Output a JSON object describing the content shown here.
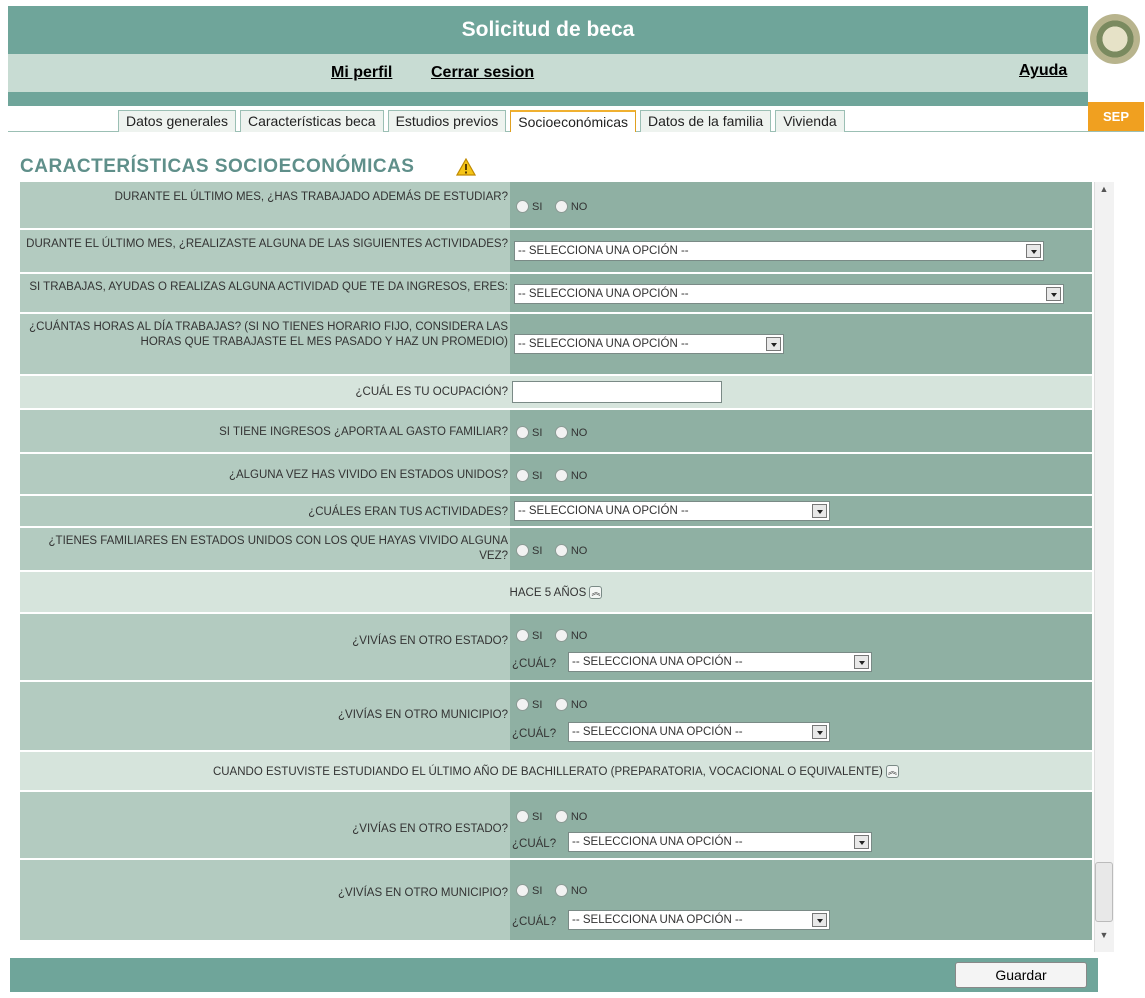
{
  "header": {
    "title": "Solicitud de beca",
    "nav": [
      "Mi perfil",
      "Cerrar sesion"
    ],
    "help": "Ayuda",
    "logo_text": "SEP"
  },
  "tabs": [
    {
      "label": "Datos generales",
      "active": false
    },
    {
      "label": "Características beca",
      "active": false
    },
    {
      "label": "Estudios previos",
      "active": false
    },
    {
      "label": "Socioeconómicas",
      "active": true
    },
    {
      "label": "Datos de la familia",
      "active": false
    },
    {
      "label": "Vivienda",
      "active": false
    }
  ],
  "section_title": "CARACTERÍSTICAS SOCIOECONÓMICAS",
  "options": {
    "yes": "SI",
    "no": "NO",
    "select_placeholder": "-- SELECCIONA UNA OPCIÓN --",
    "which_label": "¿CUÁL?"
  },
  "questions": {
    "q1": "DURANTE EL ÚLTIMO MES, ¿HAS TRABAJADO ADEMÁS DE ESTUDIAR?",
    "q2": "DURANTE EL ÚLTIMO MES, ¿REALIZASTE ALGUNA DE LAS SIGUIENTES ACTIVIDADES?",
    "q3": "SI TRABAJAS, AYUDAS O REALIZAS ALGUNA ACTIVIDAD QUE TE DA INGRESOS, ERES:",
    "q4": "¿CUÁNTAS HORAS AL DÍA TRABAJAS? (SI NO TIENES HORARIO FIJO, CONSIDERA LAS HORAS QUE TRABAJASTE EL MES PASADO Y HAZ UN PROMEDIO)",
    "q5": "¿CUÁL ES TU OCUPACIÓN?",
    "q6": "SI TIENE INGRESOS ¿APORTA AL GASTO FAMILIAR?",
    "q7": "¿ALGUNA VEZ HAS VIVIDO EN ESTADOS UNIDOS?",
    "q8": "¿CUÁLES ERAN TUS ACTIVIDADES?",
    "q9": "¿TIENES FAMILIARES EN ESTADOS UNIDOS CON LOS QUE HAYAS VIVIDO ALGUNA VEZ?",
    "other_state": "¿VIVÍAS EN OTRO ESTADO?",
    "other_municipality": "¿VIVÍAS EN OTRO MUNICIPIO?"
  },
  "subsections": {
    "s1": "HACE 5 AÑOS",
    "s2": "CUANDO ESTUVISTE ESTUDIANDO EL ÚLTIMO AÑO DE BACHILLERATO (PREPARATORIA, VOCACIONAL O EQUIVALENTE)"
  },
  "footer": {
    "save": "Guardar"
  },
  "colors": {
    "header": "#6fa59a",
    "nav": "#c8dcd3",
    "row": "#b3cbc0",
    "cell": "#8fb0a3",
    "accent": "#f0a020"
  }
}
